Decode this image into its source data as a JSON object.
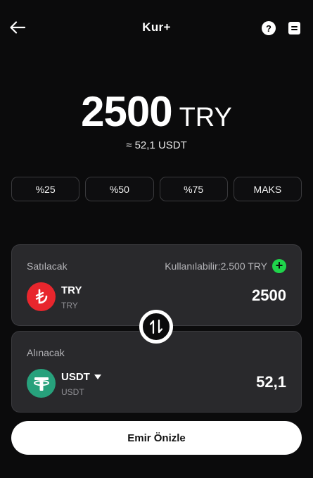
{
  "header": {
    "title": "Kur+",
    "icons": {
      "back": "arrow-left-icon",
      "help": "question-circle-icon",
      "orders": "document-icon"
    },
    "help_glyph": "?"
  },
  "amount": {
    "value": "2500",
    "currency": "TRY",
    "approx": "≈ 52,1 USDT"
  },
  "percent_chips": [
    "%25",
    "%50",
    "%75",
    "MAKS"
  ],
  "sell": {
    "label": "Satılacak",
    "available": "Kullanılabilir:2.500 TRY",
    "coin": "TRY",
    "coin_sub": "TRY",
    "coin_icon": "lira-icon",
    "amount": "2500"
  },
  "buy": {
    "label": "Alınacak",
    "coin": "USDT",
    "coin_sub": "USDT",
    "coin_icon": "tether-icon",
    "amount": "52,1"
  },
  "add_glyph": "+",
  "preview_button": "Emir Önizle",
  "colors": {
    "background": "#0b0b0c",
    "card": "#29292c",
    "accent_green": "#1fd44b",
    "try_red": "#e8262d",
    "usdt_green": "#27a17c"
  }
}
